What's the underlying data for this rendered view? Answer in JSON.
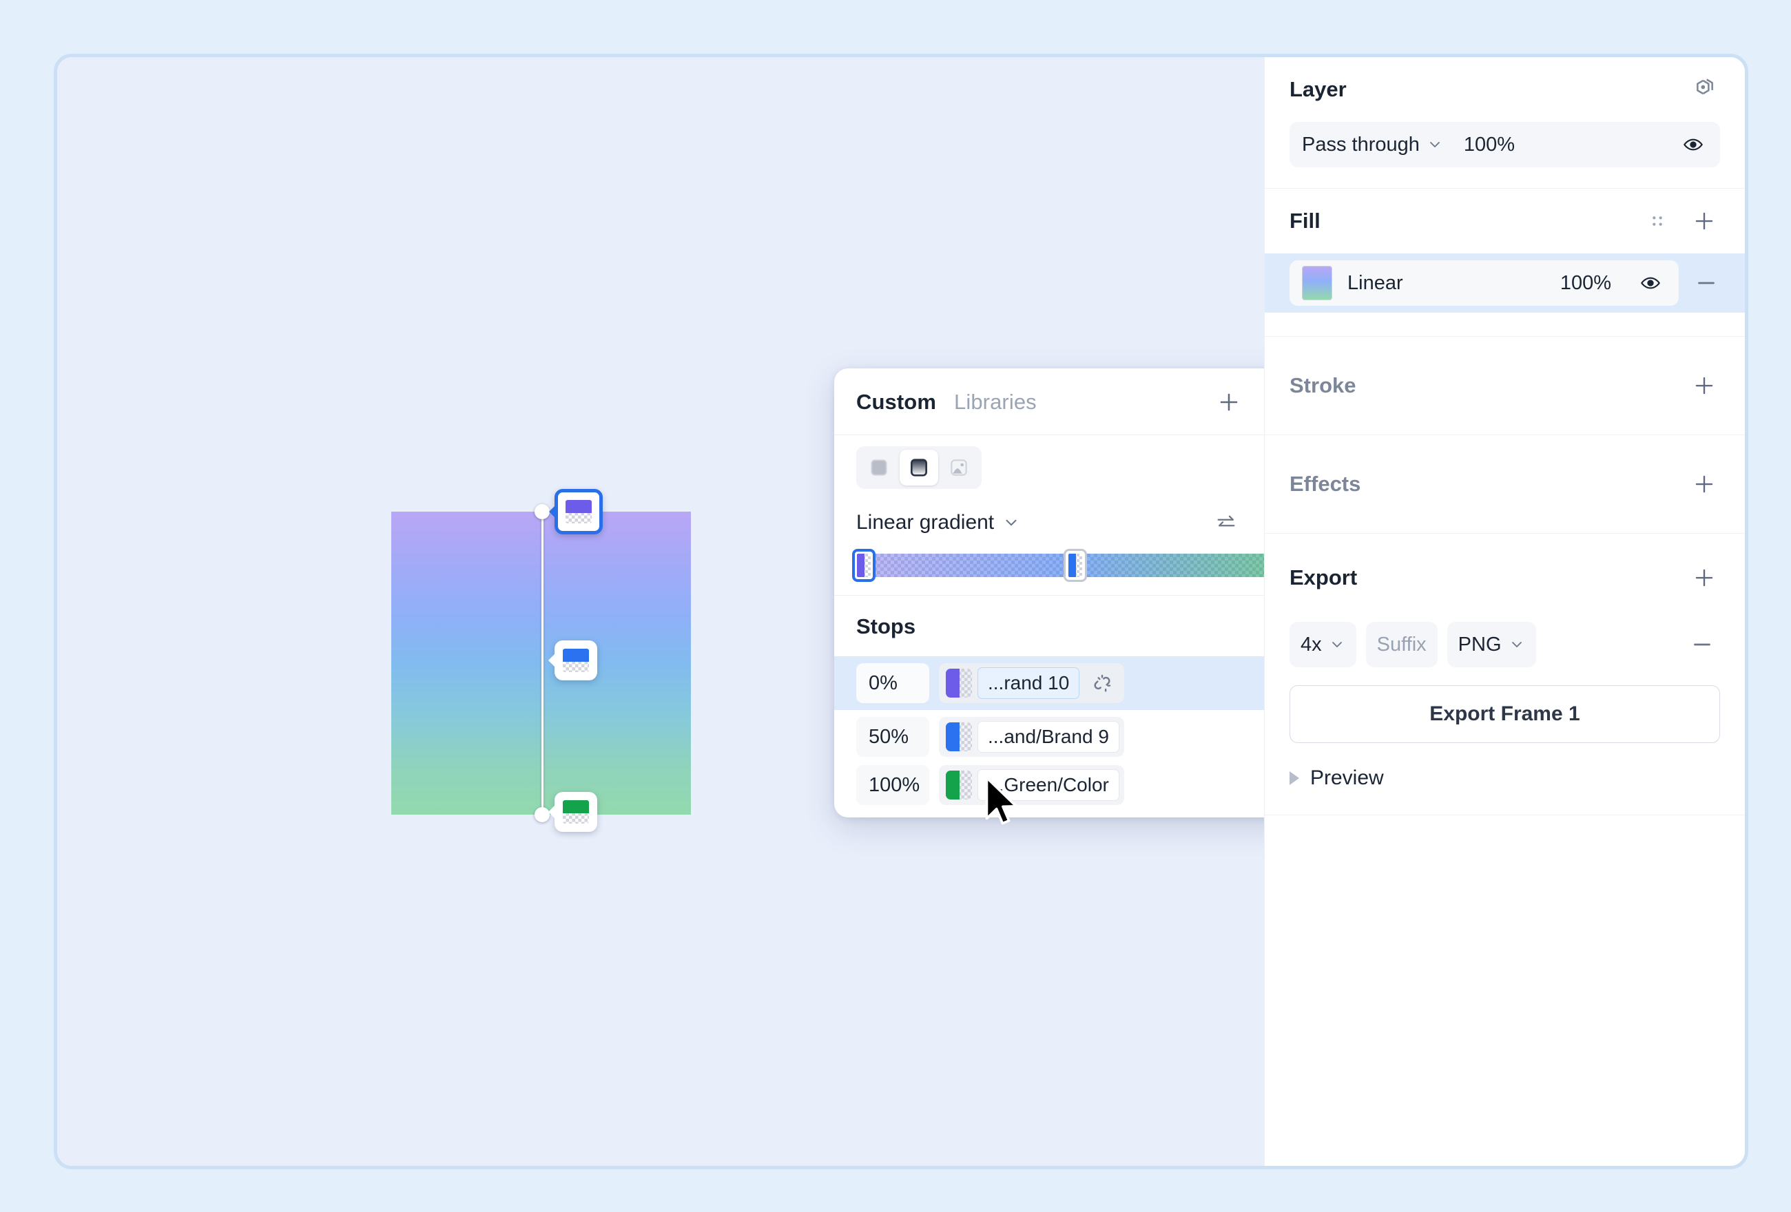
{
  "canvas": {
    "shape_name": "gradient-rectangle",
    "gradient_css": "linear-gradient(180deg,#b9a7f6 0%,#8fb0f8 34%,#82bbef 50%,#8fd3bd 84%,#93d9ad 100%)",
    "stop_chips": [
      {
        "name": "canvas-stop-0",
        "color": "#6c5ce9",
        "selected": true
      },
      {
        "name": "canvas-stop-1",
        "color": "#2a72ef",
        "selected": false
      },
      {
        "name": "canvas-stop-2",
        "color": "#14a34a",
        "selected": false
      }
    ]
  },
  "picker": {
    "tabs": [
      {
        "label": "Custom",
        "active": true
      },
      {
        "label": "Libraries",
        "active": false
      }
    ],
    "add_label": "+",
    "close_label": "×",
    "fill_types": [
      {
        "name": "solid",
        "active": false
      },
      {
        "name": "gradient",
        "active": true
      },
      {
        "name": "image",
        "active": false
      }
    ],
    "eyedropper_name": "eyedropper-icon",
    "mode_label": "Linear gradient",
    "reverse_name": "reverse-icon",
    "rotate_name": "rotate-icon",
    "bar_gradient_css": "linear-gradient(90deg, rgba(108,92,233,0.42) 0%, rgba(42,114,239,0.55) 50%, rgba(20,163,74,0.55) 100%)",
    "bar_stops": [
      {
        "pos": 0,
        "color": "#6c5ce9",
        "selected": true
      },
      {
        "pos": 50,
        "color": "#2a72ef",
        "selected": false
      },
      {
        "pos": 100,
        "color": "#14a34a",
        "selected": false
      }
    ],
    "stops_title": "Stops",
    "stops_add_label": "+",
    "stops": [
      {
        "position": "0%",
        "color": "#6c5ce9",
        "color_name": "...rand 10",
        "selected": true,
        "has_link": true,
        "remove_label": "—"
      },
      {
        "position": "50%",
        "color": "#2a72ef",
        "color_name": "...and/Brand 9",
        "selected": false,
        "has_link": false,
        "remove_label": "—"
      },
      {
        "position": "100%",
        "color": "#14a34a",
        "color_name": "...Green/Color",
        "selected": false,
        "has_link": false,
        "remove_label": "—"
      }
    ]
  },
  "sidebar": {
    "layer": {
      "title": "Layer",
      "component_icon": "component-icon",
      "blend_mode": "Pass through",
      "opacity": "100%",
      "visibility_icon": "eye-icon"
    },
    "fill": {
      "title": "Fill",
      "grid_icon": "grid-dots-icon",
      "add_label": "+",
      "item": {
        "swatch_gradient": "linear-gradient(180deg,#b9a7f6 0%,#8fb0f8 45%,#93d9ad 100%)",
        "name": "Linear",
        "opacity": "100%",
        "visibility_icon": "eye-icon",
        "remove_label": "—"
      }
    },
    "stroke": {
      "title": "Stroke",
      "add_label": "+"
    },
    "effects": {
      "title": "Effects",
      "add_label": "+"
    },
    "export": {
      "title": "Export",
      "add_label": "+",
      "scale": "4x",
      "suffix_placeholder": "Suffix",
      "format": "PNG",
      "remove_label": "—",
      "button_label": "Export Frame 1",
      "preview_label": "Preview"
    }
  },
  "colors": {
    "accent": "#2a6fe8",
    "selected_row_bg": "#ddeafb",
    "app_bg": "#e3effb",
    "canvas_bg": "#e9eefb",
    "panel_bg": "#ffffff"
  }
}
